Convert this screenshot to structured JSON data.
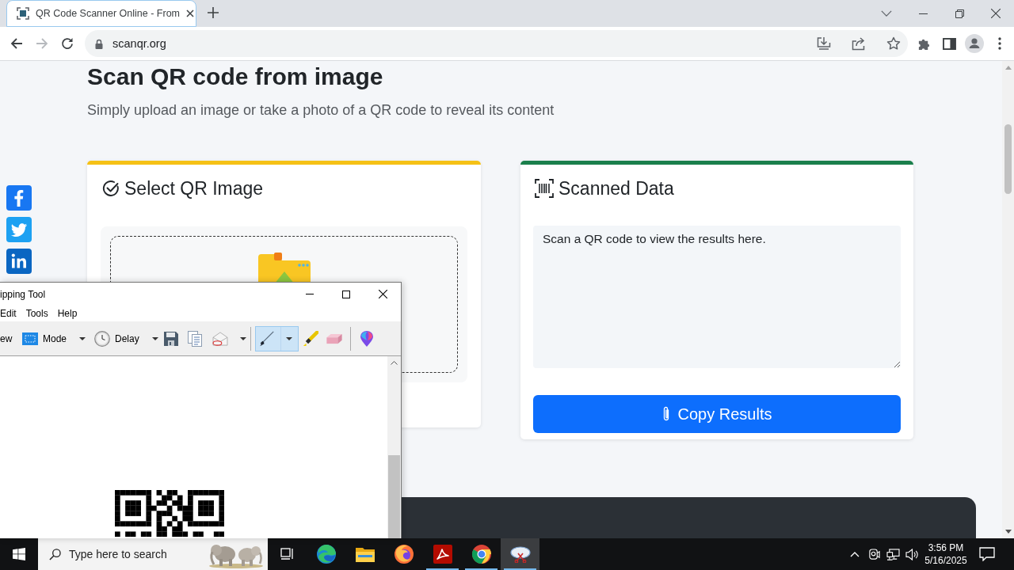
{
  "browser": {
    "tabs": [
      {
        "title": "QR Code Scanner Online - From",
        "selected": true
      }
    ],
    "back_enabled": true,
    "forward_enabled": false,
    "address": "scanqr.org"
  },
  "page": {
    "heading": "Scan QR code from image",
    "subtitle": "Simply upload an image or take a photo of a QR code to reveal its content",
    "share_buttons": [
      {
        "kind": "facebook",
        "color": "#1877f2"
      },
      {
        "kind": "twitter",
        "color": "#1da1f2"
      },
      {
        "kind": "linkedin",
        "color": "#0a66c2"
      }
    ],
    "cards": [
      {
        "kind": "upload",
        "title": "Select QR Image",
        "color": "#f5c116"
      },
      {
        "kind": "results",
        "title": "Scanned Data",
        "color": "#1b7f4c",
        "output": {
          "value": "Scan a QR code to view the results here."
        },
        "button": "Copy Results"
      }
    ]
  },
  "snipping_tool": {
    "title": "ipping Tool",
    "menu": [
      "Edit",
      "Tools",
      "Help"
    ],
    "toolbar": [
      {
        "kind": "new",
        "label": "ew"
      },
      {
        "kind": "mode",
        "label": "Mode"
      },
      {
        "kind": "delay",
        "label": "Delay"
      },
      {
        "kind": "save"
      },
      {
        "kind": "copy"
      },
      {
        "kind": "send"
      }
    ],
    "tools": [
      {
        "kind": "pen",
        "selected": true
      },
      {
        "kind": "highlighter",
        "selected": false
      },
      {
        "kind": "eraser",
        "selected": false
      }
    ],
    "extras": [
      {
        "kind": "paint3d"
      }
    ]
  },
  "taskbar": {
    "search": {
      "placeholder": "Type here to search"
    },
    "apps": [
      {
        "kind": "task-view",
        "running": false,
        "selected": false
      },
      {
        "kind": "edge",
        "running": false,
        "selected": false
      },
      {
        "kind": "explorer",
        "running": false,
        "selected": false
      },
      {
        "kind": "firefox",
        "running": false,
        "selected": false
      },
      {
        "kind": "acrobat",
        "running": true,
        "selected": false
      },
      {
        "kind": "chrome",
        "running": true,
        "selected": false
      },
      {
        "kind": "snipping",
        "running": true,
        "selected": true
      }
    ],
    "time": "3:56 PM",
    "date": "5/16/2025"
  }
}
